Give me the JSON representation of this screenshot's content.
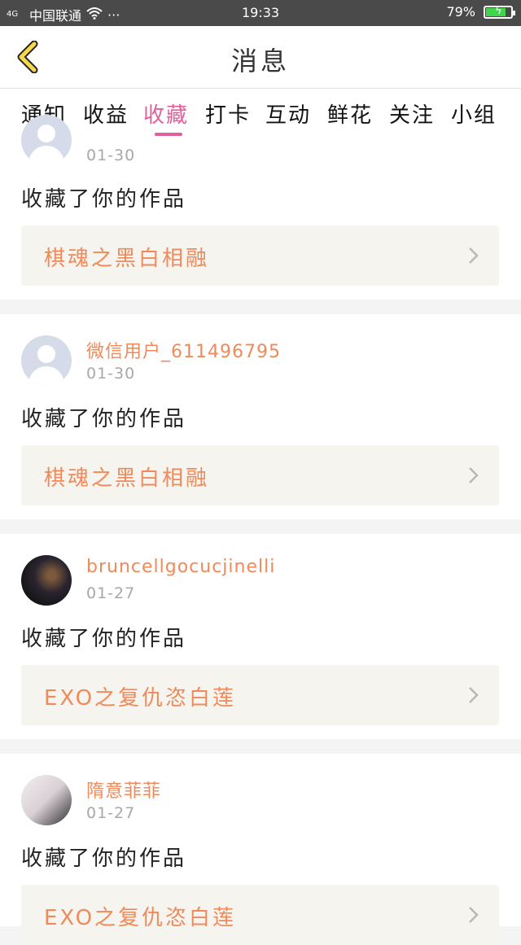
{
  "status_bar": {
    "signal": "4G",
    "carrier": "中国联通",
    "dots": "···",
    "time": "19:33",
    "battery": "79%",
    "battery_level": 0.79
  },
  "header": {
    "title": "消息"
  },
  "tabs": [
    {
      "label": "通知",
      "active": false
    },
    {
      "label": "收益",
      "active": false
    },
    {
      "label": "收藏",
      "active": true
    },
    {
      "label": "打卡",
      "active": false
    },
    {
      "label": "互动",
      "active": false
    },
    {
      "label": "鲜花",
      "active": false
    },
    {
      "label": "关注",
      "active": false
    },
    {
      "label": "小组",
      "active": false
    }
  ],
  "items": [
    {
      "user": "",
      "date": "01-30",
      "action": "收藏了你的作品",
      "work": "棋魂之黑白相融",
      "avatar": "default-avatar"
    },
    {
      "user": "微信用户_611496795",
      "date": "01-30",
      "action": "收藏了你的作品",
      "work": "棋魂之黑白相融",
      "avatar": "default-avatar"
    },
    {
      "user": "bruncellgocucjinelli",
      "date": "01-27",
      "action": "收藏了你的作品",
      "work": "EXO之复仇恣白莲",
      "avatar": "photo-avatar"
    },
    {
      "user": "隋意菲菲",
      "date": "01-27",
      "action": "收藏了你的作品",
      "work": "EXO之复仇恣白莲",
      "avatar": "photo-avatar"
    }
  ],
  "colors": {
    "accent": "#e0609a",
    "username": "#f08a5a",
    "back_icon": "#f5d94a"
  }
}
